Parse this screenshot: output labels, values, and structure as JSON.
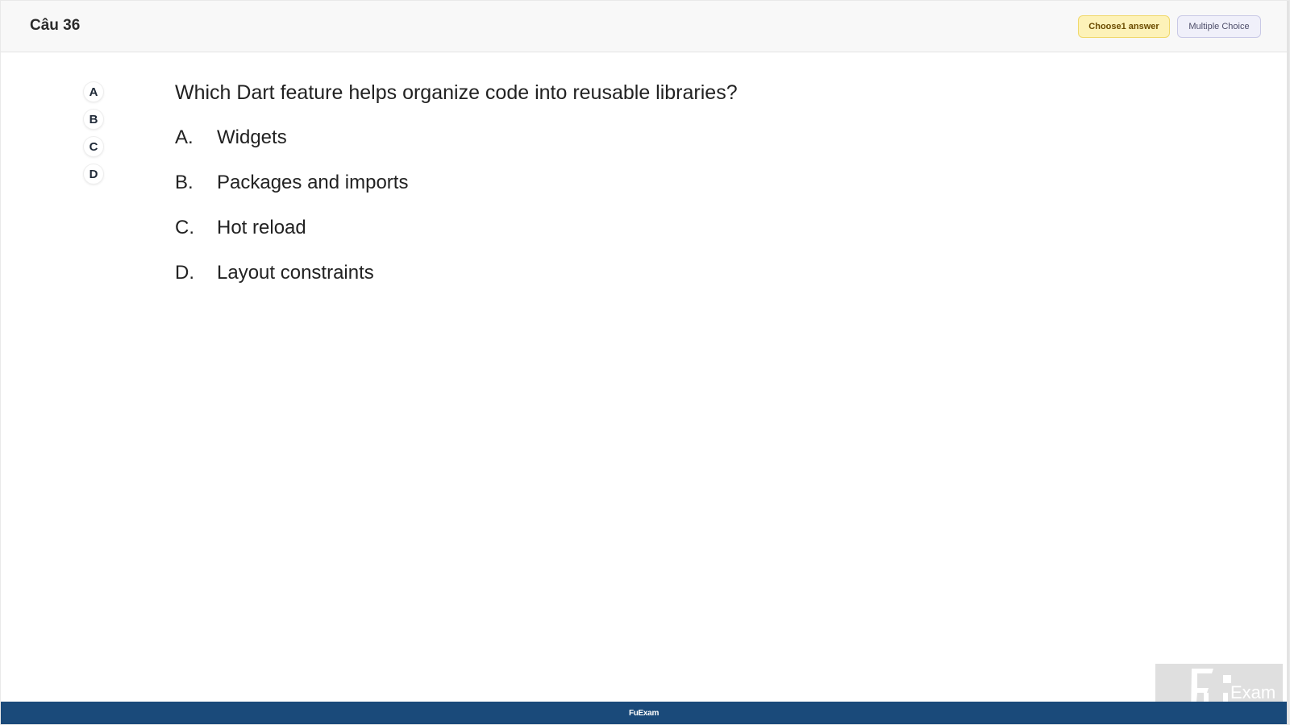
{
  "header": {
    "question_number": "Câu 36",
    "choose_label": "Choose1 answer",
    "type_label": "Multiple Choice"
  },
  "side_nav": {
    "items": [
      "A",
      "B",
      "C",
      "D"
    ]
  },
  "question": {
    "text": "Which Dart feature helps organize code into reusable libraries?",
    "options": [
      {
        "letter": "A.",
        "text": "Widgets"
      },
      {
        "letter": "B.",
        "text": "Packages and imports"
      },
      {
        "letter": "C.",
        "text": "Hot reload"
      },
      {
        "letter": "D.",
        "text": "Layout constraints"
      }
    ]
  },
  "footer": {
    "text": "FuExam"
  },
  "logo": {
    "text": "Exam",
    "icon": "fu-logo-icon"
  },
  "colors": {
    "footer_bg": "#1a4a7a",
    "choose_badge_bg": "#fdf2b8",
    "type_badge_bg": "#f0f0fa"
  }
}
